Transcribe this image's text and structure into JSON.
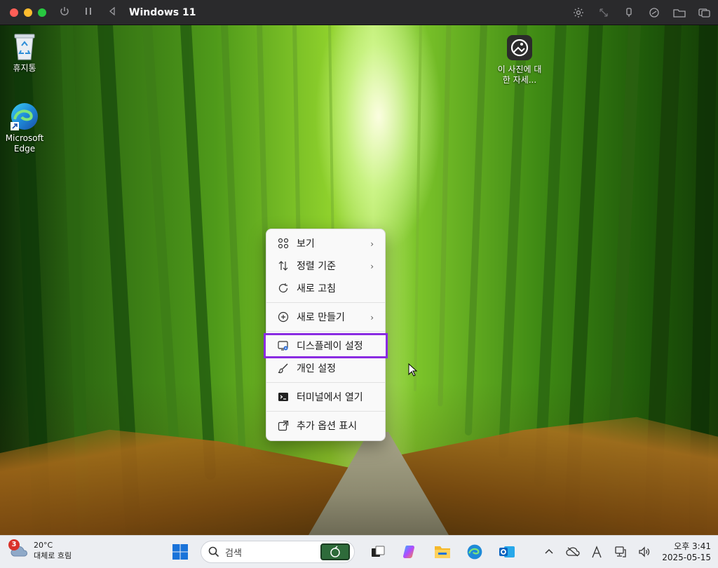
{
  "window": {
    "title": "Windows 11"
  },
  "desktop": {
    "icons": [
      {
        "label": "휴지통",
        "icon": "recycle-bin-icon"
      },
      {
        "label": "Microsoft Edge",
        "icon": "edge-icon"
      },
      {
        "label": "이 사진에 대한 자세...",
        "icon": "learn-about-picture-icon"
      }
    ]
  },
  "context_menu": {
    "items": [
      {
        "label": "보기",
        "icon": "view-grid-icon",
        "submenu": true
      },
      {
        "label": "정렬 기준",
        "icon": "sort-icon",
        "submenu": true
      },
      {
        "label": "새로 고침",
        "icon": "refresh-icon",
        "submenu": false
      },
      {
        "label": "새로 만들기",
        "icon": "new-plus-icon",
        "submenu": true
      },
      {
        "label": "디스플레이 설정",
        "icon": "display-settings-icon",
        "submenu": false,
        "highlighted": true
      },
      {
        "label": "개인 설정",
        "icon": "brush-icon",
        "submenu": false
      },
      {
        "label": "터미널에서 열기",
        "icon": "terminal-icon",
        "submenu": false
      },
      {
        "label": "추가 옵션 표시",
        "icon": "more-options-icon",
        "submenu": false
      }
    ],
    "chevron": "›",
    "highlight_color": "#8a2be2"
  },
  "taskbar": {
    "weather": {
      "badge": "3",
      "temperature": "20°C",
      "condition": "대체로 흐림"
    },
    "search": {
      "placeholder": "검색"
    },
    "apps": [
      "windows-start-icon",
      "task-view-icon",
      "copilot-icon",
      "file-explorer-icon",
      "edge-icon",
      "outlook-icon"
    ],
    "tray": {
      "chevron": "^",
      "time": "오후 3:41",
      "date": "2025-05-15"
    }
  }
}
